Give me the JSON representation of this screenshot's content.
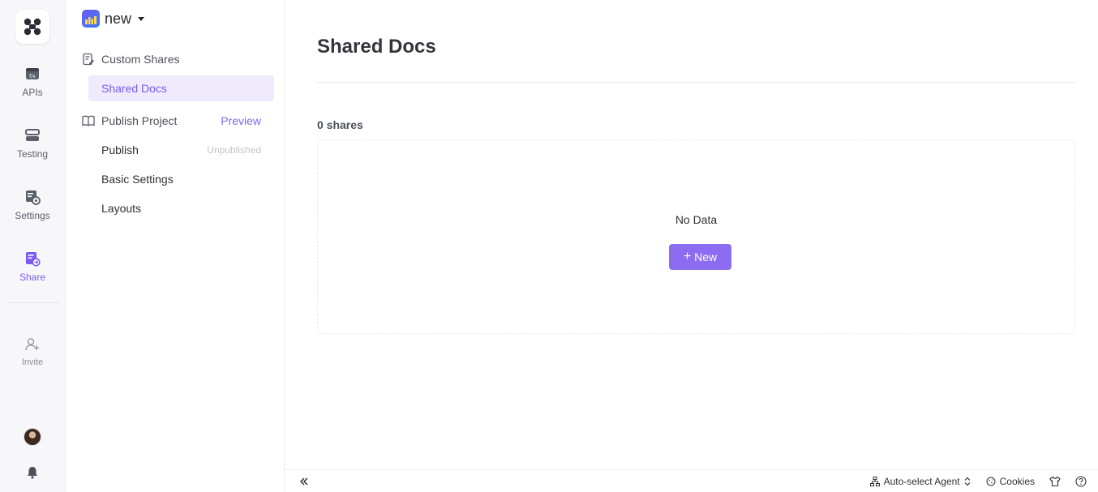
{
  "rail": {
    "items": [
      {
        "label": "APIs",
        "icon": "api-icon"
      },
      {
        "label": "Testing",
        "icon": "testing-icon"
      },
      {
        "label": "Settings",
        "icon": "settings-icon"
      },
      {
        "label": "Share",
        "icon": "share-icon",
        "active": true
      },
      {
        "label": "Invite",
        "icon": "invite-user-icon"
      }
    ]
  },
  "project": {
    "name": "new"
  },
  "sidebar": {
    "custom_shares": {
      "heading": "Custom Shares",
      "items": [
        {
          "label": "Shared Docs",
          "active": true
        }
      ]
    },
    "publish_project": {
      "heading": "Publish Project",
      "action": "Preview",
      "items": [
        {
          "label": "Publish",
          "badge": "Unpublished"
        },
        {
          "label": "Basic Settings"
        },
        {
          "label": "Layouts"
        }
      ]
    }
  },
  "main": {
    "title": "Shared Docs",
    "share_count": "0 shares",
    "empty_text": "No Data",
    "new_button": "New"
  },
  "footer": {
    "agent_label": "Auto-select Agent",
    "cookies_label": "Cookies"
  },
  "colors": {
    "accent": "#8c6cf1",
    "accent_text": "#7a5af0",
    "active_bg": "#efebfd"
  }
}
